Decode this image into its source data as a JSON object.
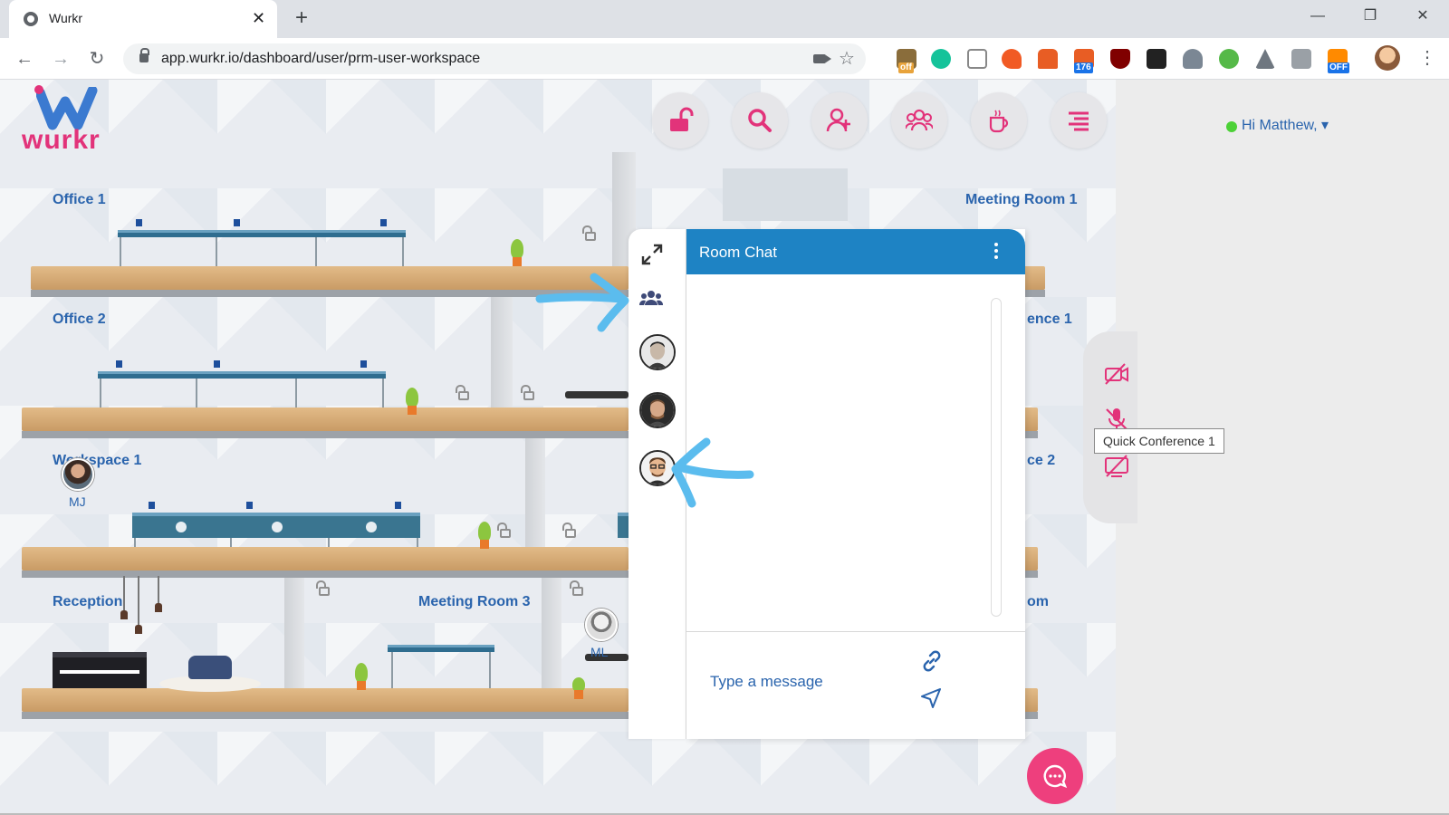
{
  "browser": {
    "tab_title": "Wurkr",
    "tab_close": "✕",
    "new_tab": "+",
    "url": "app.wurkr.io/dashboard/user/prm-user-workspace",
    "minimize": "—",
    "restore": "❐",
    "close": "✕",
    "back": "←",
    "forward": "→",
    "reload": "↻",
    "star": "☆",
    "menu": "⋮",
    "extension_badges": [
      "off",
      "176",
      "OFF"
    ]
  },
  "app": {
    "logo_text": "wurkr",
    "greeting": "Hi Matthew, ▾",
    "top_buttons": [
      "unlock-icon",
      "search-icon",
      "add-user-icon",
      "group-icon",
      "coffee-icon",
      "menu-icon"
    ],
    "rooms": [
      {
        "key": "office1",
        "label": "Office 1"
      },
      {
        "key": "office2",
        "label": "Office 2"
      },
      {
        "key": "workspace1",
        "label": "Workspace 1"
      },
      {
        "key": "reception",
        "label": "Reception"
      },
      {
        "key": "meeting3",
        "label": "Meeting Room 3"
      },
      {
        "key": "meeting1",
        "label": "Meeting Room 1"
      },
      {
        "key": "conf1_partial",
        "label": "ence 1"
      },
      {
        "key": "space2_partial",
        "label": "ce 2"
      },
      {
        "key": "room_partial",
        "label": "om"
      }
    ],
    "map_avatars": [
      {
        "initials": "MJ"
      },
      {
        "initials": "ML"
      }
    ]
  },
  "conference_panel": {
    "icons": [
      "video-off-icon",
      "mic-off-icon",
      "screen-share-off-icon"
    ],
    "tooltip": "Quick Conference 1"
  },
  "room_chat": {
    "title": "Room Chat",
    "input_placeholder": "Type a message",
    "rail_icons": [
      "expand-icon",
      "participants-icon"
    ]
  },
  "colors": {
    "brand_pink": "#e2337a",
    "fab_pink": "#ee3f7d",
    "chat_header_blue": "#1e83c4",
    "label_blue": "#2a64ad",
    "status_green": "#4cd137",
    "annotation_arrow": "#5bbcee"
  }
}
